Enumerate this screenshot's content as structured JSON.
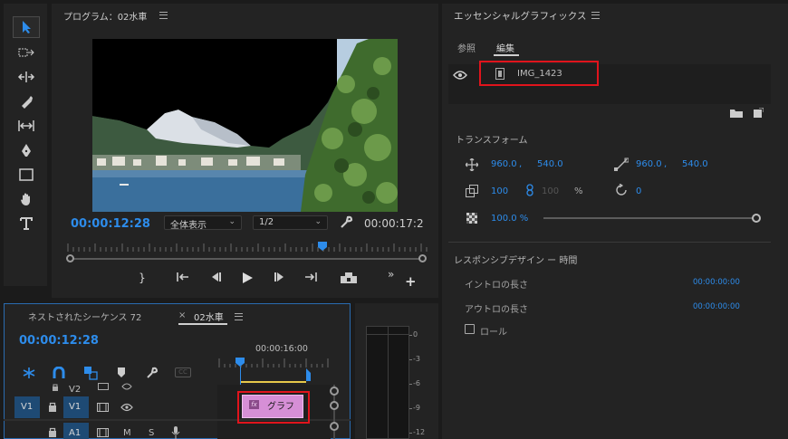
{
  "program": {
    "title": "プログラム：02水車",
    "timecode_current": "00:00:12:28",
    "timecode_end": "00:00:17:2",
    "zoom_select": "全体表示",
    "resolution_select": "1/2"
  },
  "essential": {
    "title": "エッセンシャルグラフィックス",
    "tabs": [
      "参照",
      "編集"
    ],
    "layer_name": "IMG_1423",
    "transform_heading": "トランスフォーム",
    "pos_x": "960.0",
    "pos_y": "540.0",
    "sep": ",",
    "anchor_x": "960.0",
    "anchor_y": "540.0",
    "scale": "100",
    "scale_linked": "100",
    "percent": "%",
    "rotation": "0",
    "opacity": "100.0 %",
    "opacity_level": 1.0,
    "responsive_heading": "レスポンシブデザイン ー 時間",
    "intro_label": "イントロの長さ",
    "intro_value": "00:00:00:00",
    "outro_label": "アウトロの長さ",
    "outro_value": "00:00:00:00",
    "roll_label": "ロール"
  },
  "timeline": {
    "tab_nested": "ネストされたシーケンス 72",
    "tab_close": "×",
    "tab_active": "02水車",
    "timecode": "00:00:12:28",
    "ruler_time": "00:00:16:00",
    "tracks": {
      "v2": "V2",
      "v1_source": "V1",
      "v1": "V1",
      "a1": "A1",
      "m": "M",
      "s": "S"
    },
    "clip_fx": "fx",
    "clip_name": "グラフ"
  },
  "meter": {
    "ticks": [
      "0",
      "-3",
      "-6",
      "-9",
      "-12"
    ]
  },
  "controls": {
    "mark_out": "}",
    "plus": "+",
    "more": "»"
  },
  "colors": {
    "accent": "#2d8ceb",
    "highlight": "#e0141c",
    "clip": "#d68fd6"
  }
}
